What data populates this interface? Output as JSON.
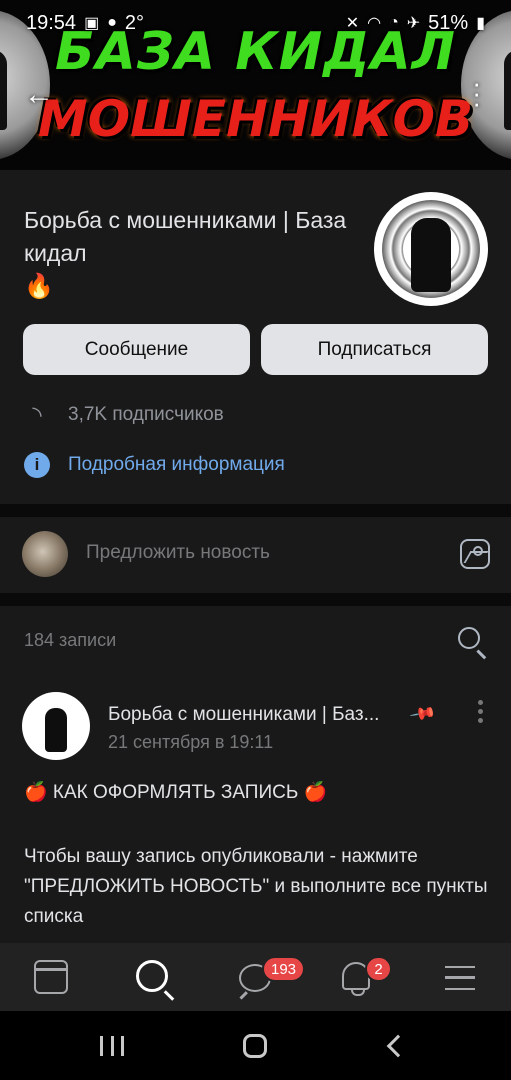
{
  "status_bar": {
    "time": "19:54",
    "temperature": "2°",
    "battery": "51%"
  },
  "banner": {
    "line1": "БАЗА КИДАЛ",
    "line2": "МОШЕННИКОВ"
  },
  "group": {
    "name": "Борьба с мошенниками | База кидал",
    "emoji": "🔥",
    "message_button": "Сообщение",
    "subscribe_button": "Подписаться",
    "subscribers": "3,7K подписчиков",
    "details_link": "Подробная информация"
  },
  "suggest": {
    "placeholder": "Предложить новость"
  },
  "posts": {
    "count_label": "184 записи",
    "first": {
      "author": "Борьба с мошенниками | Баз...",
      "date": "21 сентября в 19:11",
      "title": "🍎 КАК ОФОРМЛЯТЬ ЗАПИСЬ 🍎",
      "body": "Чтобы вашу запись опубликовали - нажмите \"ПРЕДЛОЖИТЬ НОВОСТЬ\" и выполните все пункты списка"
    }
  },
  "tab_bar": {
    "messages_badge": "193",
    "notifications_badge": "2"
  },
  "colors": {
    "background": "#0a0a0a",
    "card": "#191919",
    "link": "#71aaeb",
    "badge": "#e64646"
  }
}
